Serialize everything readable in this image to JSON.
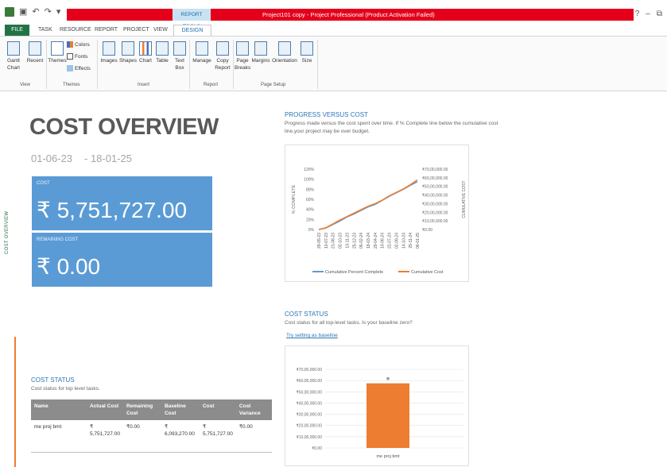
{
  "titlebar": {
    "report_tools": "REPORT TOOLS",
    "title": "Project101 copy - Project Professional (Product Activation Failed)",
    "help": "?",
    "minimize": "–",
    "restore": "⧉"
  },
  "tabs": [
    "FILE",
    "TASK",
    "RESOURCE",
    "REPORT",
    "PROJECT",
    "VIEW",
    "DESIGN"
  ],
  "ribbon": {
    "view": {
      "gantt": "Gantt Chart",
      "recent": "Recent",
      "label": "View"
    },
    "themes": {
      "themes": "Themes",
      "colors": "Colors",
      "fonts": "Fonts",
      "effects": "Effects",
      "label": "Themes"
    },
    "insert": {
      "images": "Images",
      "shapes": "Shapes",
      "chart": "Chart",
      "table": "Table",
      "textbox": "Text Box",
      "label": "Insert"
    },
    "report": {
      "manage": "Manage",
      "copy": "Copy Report",
      "label": "Report"
    },
    "page_setup": {
      "breaks": "Page Breaks",
      "margins": "Margins",
      "orientation": "Orientation",
      "size": "Size",
      "label": "Page Setup"
    }
  },
  "report": {
    "side_tab": "COST OVERVIEW",
    "title": "COST OVERVIEW",
    "start_date": "01-06-23",
    "end_date": "- 18-01-25",
    "cost_label": "COST",
    "cost_value": "₹ 5,751,727.00",
    "remaining_label": "REMAINING COST",
    "remaining_value": "₹ 0.00",
    "progress": {
      "title": "PROGRESS VERSUS COST",
      "desc1": "Progress made versus the cost spent over time. If % Complete line below the cumulative cost",
      "desc2": "line,your project may be over budget."
    },
    "cost_status_right": {
      "title": "COST STATUS",
      "desc": "Cost status for all top-level tasks. Is your baseline zero?",
      "link": "Try setting as baseline"
    },
    "cost_status_left": {
      "title": "COST STATUS",
      "desc": "Cost status for top level tasks.",
      "headers": [
        "Name",
        "Actual Cost",
        "Remaining Cost",
        "Baseline Cost",
        "Cost",
        "Cost Variance"
      ],
      "rows": [
        [
          "me proj bmt",
          "₹ 5,751,727.00",
          "₹0.00",
          "₹ 6,093,270.00",
          "₹ 5,751,727.00",
          "₹0.00"
        ]
      ]
    }
  },
  "chart_data": [
    {
      "type": "line",
      "title": "",
      "ylabel": "% COMPLETE",
      "y2label": "CUMULATIVE COST",
      "yticks": [
        "120%",
        "100%",
        "80%",
        "60%",
        "40%",
        "20%",
        "0%"
      ],
      "y2ticks": [
        "₹70,00,000.00",
        "₹60,00,000.00",
        "₹50,00,000.00",
        "₹40,00,000.00",
        "₹30,00,000.00",
        "₹20,00,000.00",
        "₹10,00,000.00",
        "₹0.00"
      ],
      "ylim": [
        0,
        120
      ],
      "y2lim": [
        0,
        7000000
      ],
      "categories": [
        "29-05-23",
        "10-07-23",
        "21-08-23",
        "02-10-23",
        "13-11-23",
        "25-12-23",
        "05-02-24",
        "18-03-24",
        "29-04-24",
        "10-06-24",
        "22-07-24",
        "02-09-24",
        "14-10-24",
        "25-11-24",
        "06-01-25"
      ],
      "series": [
        {
          "name": "Cumulative Percent Complete",
          "color": "#5b9bd5",
          "values": [
            0,
            3,
            10,
            17,
            25,
            31,
            38,
            45,
            50,
            58,
            66,
            73,
            80,
            88,
            95
          ]
        },
        {
          "name": "Cumulative Cost",
          "color": "#ed7d31",
          "values": [
            0,
            200000,
            650000,
            1100000,
            1500000,
            1900000,
            2300000,
            2700000,
            3000000,
            3400000,
            3900000,
            4300000,
            4700000,
            5200000,
            5751727
          ]
        }
      ],
      "legend": "bottom"
    },
    {
      "type": "bar",
      "categories": [
        "me proj bmt"
      ],
      "values": [
        5751727
      ],
      "ylim": [
        0,
        7000000
      ],
      "yticks": [
        "₹70,00,000.00",
        "₹60,00,000.00",
        "₹50,00,000.00",
        "₹40,00,000.00",
        "₹30,00,000.00",
        "₹20,00,000.00",
        "₹10,00,000.00",
        "₹0.00"
      ],
      "color": "#ed7d31",
      "grid": true
    }
  ]
}
